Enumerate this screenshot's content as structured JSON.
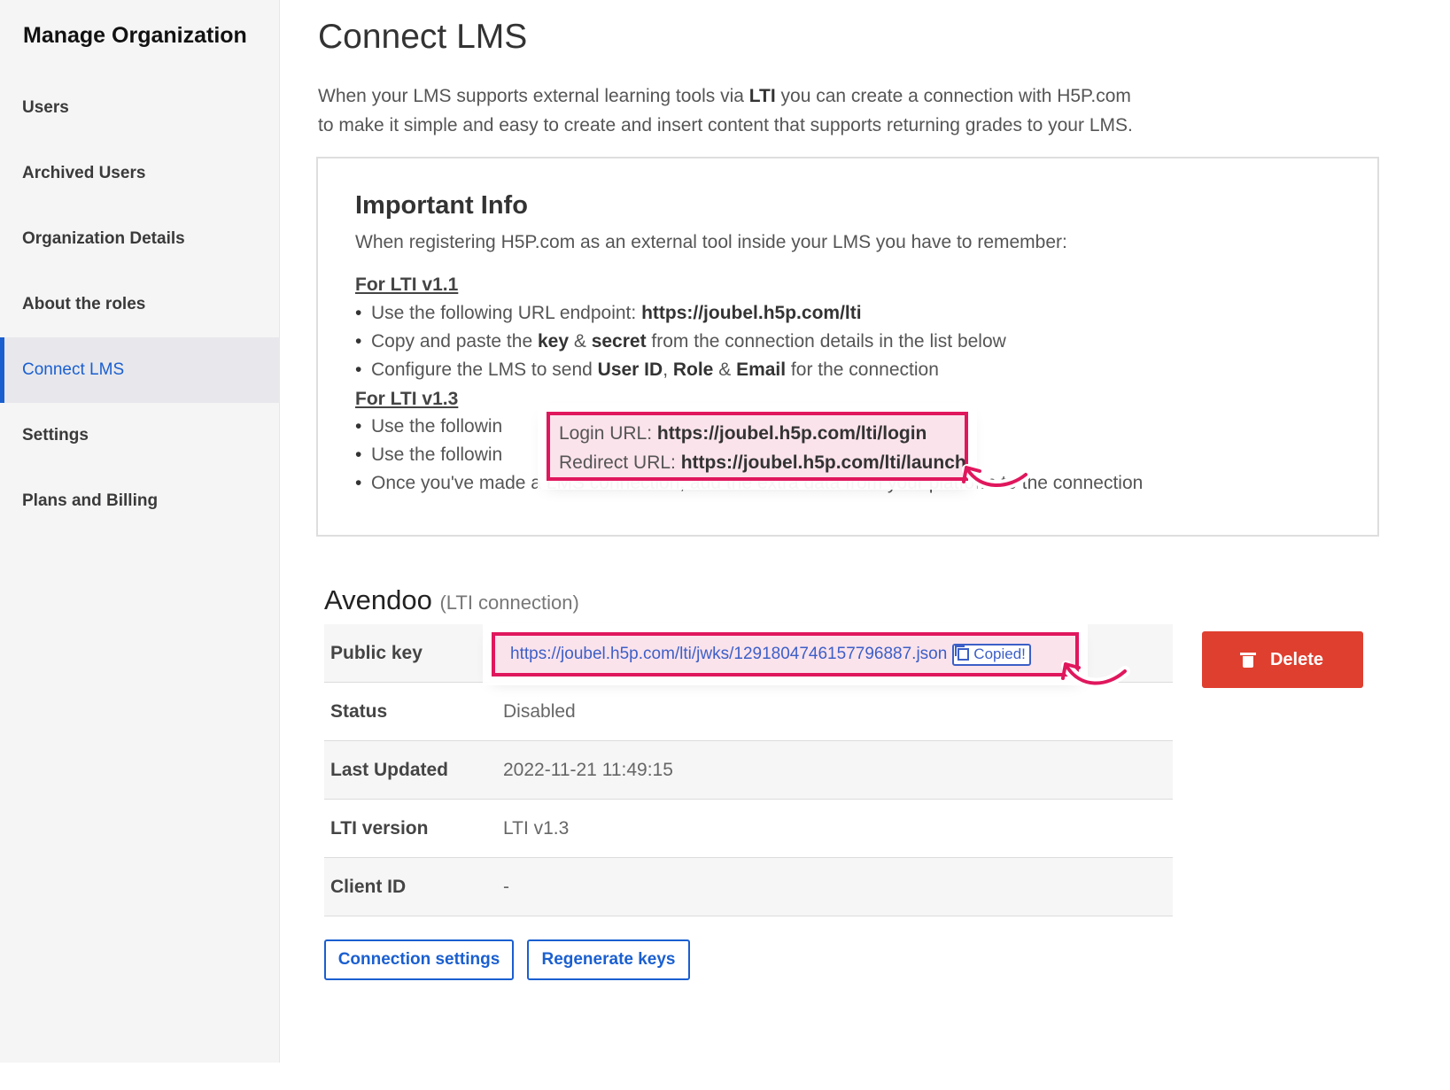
{
  "sidebar": {
    "title": "Manage Organization",
    "items": [
      {
        "label": "Users"
      },
      {
        "label": "Archived Users"
      },
      {
        "label": "Organization Details"
      },
      {
        "label": "About the roles"
      },
      {
        "label": "Connect LMS"
      },
      {
        "label": "Settings"
      },
      {
        "label": "Plans and Billing"
      }
    ],
    "active_item": "Connect LMS"
  },
  "main": {
    "title": "Connect LMS",
    "intro": {
      "part1": "When your LMS supports external learning tools via ",
      "bold": "LTI",
      "part2": " you can create a connection with H5P.com",
      "line2": "to make it simple and easy to create and insert content that supports returning grades to your LMS."
    },
    "info": {
      "title": "Important Info",
      "subtitle": "When registering H5P.com as an external tool inside your LMS you have to remember:",
      "lti11": {
        "heading": "For LTI v1.1",
        "b1_text": "Use the following URL endpoint: ",
        "b1_bold": "https://joubel.h5p.com/lti",
        "b2_t1": "Copy and paste the ",
        "b2_key": "key",
        "b2_t2": " & ",
        "b2_secret": "secret",
        "b2_t3": " from the connection details in the list below",
        "b3_t1": "Configure the LMS to send ",
        "b3_userid": "User ID",
        "b3_t2": ", ",
        "b3_role": "Role",
        "b3_t3": " & ",
        "b3_email": "Email",
        "b3_t4": " for the connection"
      },
      "lti13": {
        "heading": "For LTI v1.3",
        "b1_text": "Use the followin",
        "b2_text": "Use the followin",
        "b3_text": "Once you've made a LMS connection, add the extra data from your platform to the connection",
        "login_label": "Login URL: ",
        "login_url": "https://joubel.h5p.com/lti/login",
        "redirect_label": "Redirect URL: ",
        "redirect_url": "https://joubel.h5p.com/lti/launch"
      }
    },
    "connection": {
      "name": "Avendoo",
      "type": "(LTI connection)",
      "rows": [
        {
          "key": "Public key",
          "value": ""
        },
        {
          "key": "Status",
          "value": "Disabled"
        },
        {
          "key": "Last Updated",
          "value": "2022-11-21 11:49:15"
        },
        {
          "key": "LTI version",
          "value": "LTI v1.3"
        },
        {
          "key": "Client ID",
          "value": "-"
        }
      ],
      "public_key_url": "https://joubel.h5p.com/lti/jwks/1291804746157796887.json",
      "copied_label": "Copied!",
      "delete_label": "Delete",
      "connection_settings_label": "Connection settings",
      "regenerate_keys_label": "Regenerate keys"
    }
  },
  "colors": {
    "accent": "#1a5fd0",
    "delete": "#df3f2f",
    "highlight": "#e0175d",
    "link": "#3c5fc7"
  }
}
